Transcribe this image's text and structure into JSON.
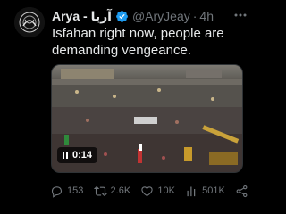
{
  "tweet": {
    "author_name": "Arya - آریا",
    "handle": "@AryJeay",
    "separator": "·",
    "time": "4h",
    "verified_icon": "verified-badge-icon",
    "text": "Isfahan right now, people are demanding vengeance.",
    "video": {
      "elapsed": "0:14",
      "state_icon": "pause-icon"
    },
    "actions": {
      "replies": "153",
      "reposts": "2.6K",
      "likes": "10K",
      "views": "501K"
    }
  },
  "colors": {
    "background": "#000000",
    "text": "#e7e9ea",
    "muted": "#71767b",
    "verified": "#1d9bf0"
  }
}
